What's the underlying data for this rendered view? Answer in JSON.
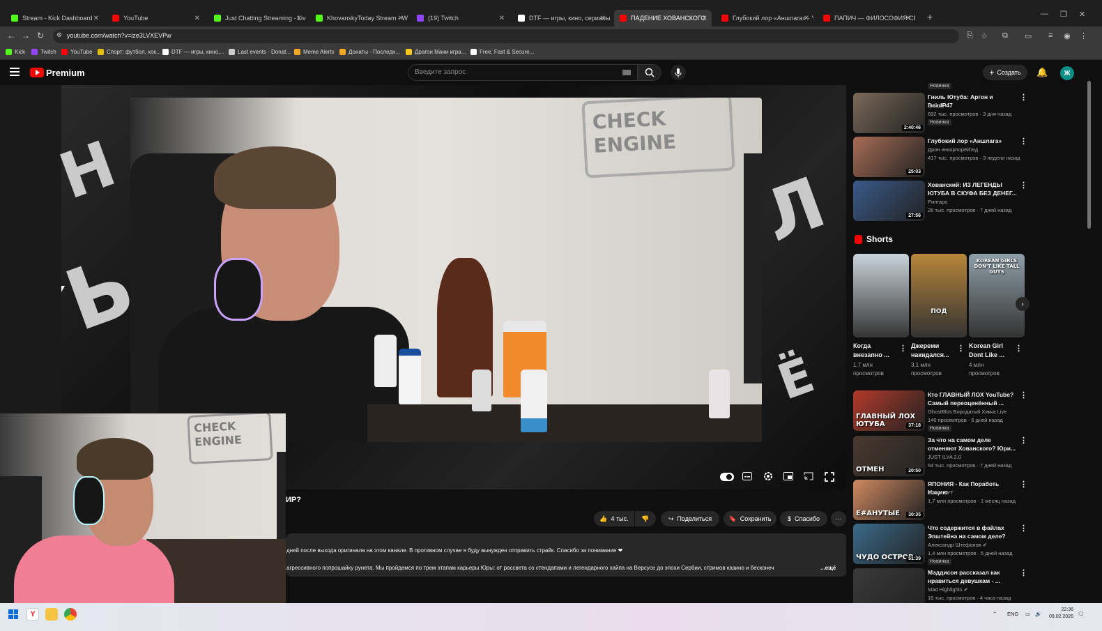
{
  "browser": {
    "tabs": [
      {
        "label": "Stream - Kick Dashboard",
        "color": "#53fc18"
      },
      {
        "label": "YouTube",
        "color": "#ff0000"
      },
      {
        "label": "Just Chatting Streaming - Live",
        "color": "#53fc18"
      },
      {
        "label": "KhovanskyToday Stream - Wat",
        "color": "#53fc18"
      },
      {
        "label": "(19) Twitch",
        "color": "#9146ff"
      },
      {
        "label": "DTF — игры, кино, сериалы, р",
        "color": "#ffffff"
      },
      {
        "label": "ПАДЕНИЕ ХОВАНСКОГО",
        "color": "#ff0000"
      },
      {
        "label": "Глубокий лор «Аншлага» - Yo",
        "color": "#ff0000"
      },
      {
        "label": "ПАПИЧ — ФИЛОСОФИЯ СВО",
        "color": "#ff0000"
      }
    ],
    "url": "youtube.com/watch?v=ize3LVXEVPw",
    "bookmarks": [
      {
        "label": "Kick",
        "color": "#53fc18"
      },
      {
        "label": "Twitch",
        "color": "#9146ff"
      },
      {
        "label": "YouTube",
        "color": "#ff0000"
      },
      {
        "label": "Спорт: футбол, хок...",
        "color": "#e0c000"
      },
      {
        "label": "DTF — игры, кино,...",
        "color": "#ffffff"
      },
      {
        "label": "Last events · Donat...",
        "color": "#cccccc"
      },
      {
        "label": "Meme Alerts",
        "color": "#f5a623"
      },
      {
        "label": "Донаты - Последн...",
        "color": "#f5a623"
      },
      {
        "label": "Драгон Мани игра...",
        "color": "#f5c518"
      },
      {
        "label": "Free, Fast & Secure...",
        "color": "#ffffff"
      }
    ]
  },
  "header": {
    "brand": "Premium",
    "search_placeholder": "Введите запрос",
    "create_label": "Создать",
    "avatar_letter": "Ж"
  },
  "video": {
    "title_fragment": "ИР?",
    "actions": {
      "likes": "4 тыс.",
      "share": "Поделиться",
      "save": "Сохранить",
      "thanks": "Спасибо",
      "more": "⋯"
    },
    "description_line1": "дней после выхода оригинала на этом канале. В противном случае я буду вынужден отправить страйк. Спасибо за понимание ❤",
    "description_line2": "агрессивного попрошайку рунета. Мы пройдемся по трем этапам карьеры Юры: от рассвета со стендапами и легендарного хайпа на Версусе до эпохи Сербии, стримов казино и бесконеч",
    "more_link": "...ещё",
    "frame_sign": "CHECK\nENGINE",
    "webcam_sign": "CHECK\nENGINE"
  },
  "sidebar": {
    "top_badge": "Новинка",
    "videos_top": [
      {
        "title": "Гниль Ютуба: Аргон и DeadP47",
        "channel": "Бибой ✔",
        "meta": "692 тыс. просмотров · 3 дня назад",
        "badge": "Новинка",
        "duration": "2:40:46",
        "thumb": "#7a6a5a"
      },
      {
        "title": "Глубокий лор «Аншлага»",
        "channel": "Дрон инкорпорейтед",
        "meta": "417 тыс. просмотров · 3 недели назад",
        "badge": "",
        "duration": "25:03",
        "thumb": "#a86c55"
      },
      {
        "title": "Хованский: ИЗ ЛЕГЕНДЫ ЮТУБА В СКУФА БЕЗ ДЕНЕГ...",
        "channel": "Рингаро",
        "meta": "26 тыс. просмотров · 7 дней назад",
        "badge": "",
        "duration": "27:56",
        "thumb": "#3a5a8a"
      }
    ],
    "shorts_title": "Shorts",
    "shorts": [
      {
        "title": "Когда внезапно ...",
        "views": "1,7 млн просмотров",
        "thumb": "#c9d3da"
      },
      {
        "title": "Джереми накидался...",
        "views": "3,1 млн просмотров",
        "thumb": "#b8863a",
        "label": "ПОД"
      },
      {
        "title": "Korean Girl Dont Like ...",
        "views": "4 млн просмотров",
        "thumb": "#8f9fa8",
        "label": "KOREAN GIRLS DON'T LIKE TALL GUYS"
      }
    ],
    "videos_bottom": [
      {
        "title": "Кто ГЛАВНЫЙ ЛОХ YouTube? Самый переоценённый ...",
        "channel": "GhostBlos Бородатый Хикка Live",
        "meta": "140 просмотров · 5 дней назад",
        "badge": "Новинка",
        "duration": "37:18",
        "thumb": "#b33a2a",
        "overlay": "ГЛАВНЫЙ ЛОХ ЮТУБА"
      },
      {
        "title": "За что на самом деле отменяют Хованского? Юри...",
        "channel": "JUST ILYA 2.0",
        "meta": "54 тыс. просмотров · 7 дней назад",
        "badge": "",
        "duration": "20:50",
        "thumb": "#4a3a30",
        "overlay": "ОТМЕН"
      },
      {
        "title": "ЯПОНИЯ - Как Поработь Нацию",
        "channel": "ТОНИ ТУТ",
        "meta": "1,7 млн просмотров · 1 месяц назад",
        "badge": "",
        "duration": "30:35",
        "thumb": "#d08a60",
        "overlay": "Е#АНУТЫЕ"
      },
      {
        "title": "Что содержится в файлах Эпштейна на самом деле?",
        "channel": "Александр Штефанов ✔",
        "meta": "1,4 млн просмотров · 5 дней назад",
        "badge": "Новинка",
        "duration": "51:39",
        "thumb": "#3a6a8a",
        "overlay": "ЧУДО ОСТРОВ"
      },
      {
        "title": "Мэддисон рассказал как нравиться девушкам - ...",
        "channel": "Mad Highlights ✔",
        "meta": "16 тыс. просмотров · 4 часа назад",
        "badge": "",
        "duration": "",
        "thumb": "#3a3a3a",
        "overlay": ""
      }
    ]
  },
  "taskbar": {
    "lang": "ENG",
    "time": "22:36",
    "date": "09.02.2026"
  },
  "colors": {
    "yt_red": "#ff0000",
    "background": "#0f0f0f",
    "pill": "#272727",
    "avatar": "#0a8f86"
  }
}
